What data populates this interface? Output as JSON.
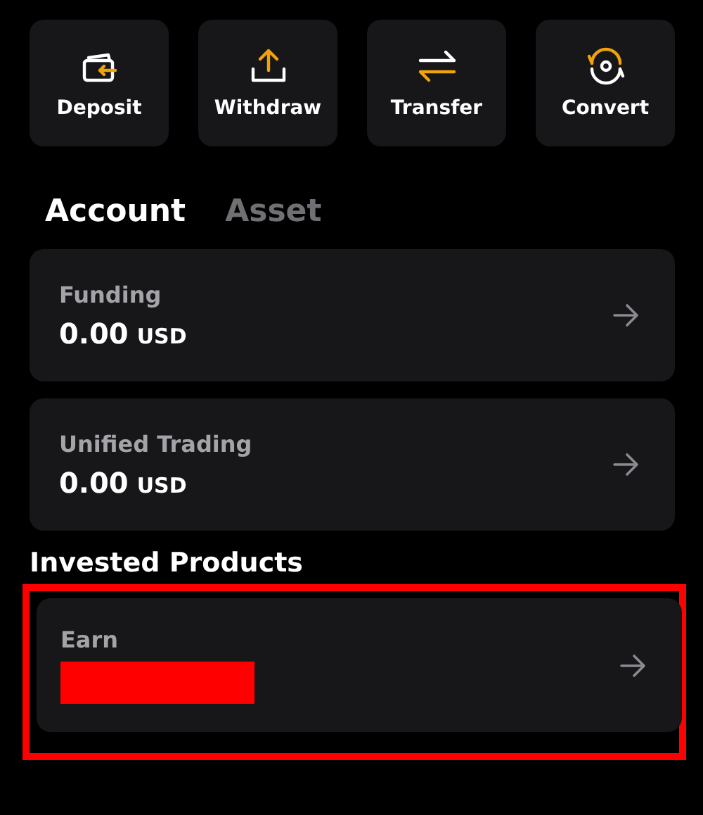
{
  "actions": [
    {
      "label": "Deposit",
      "kind": "deposit"
    },
    {
      "label": "Withdraw",
      "kind": "withdraw"
    },
    {
      "label": "Transfer",
      "kind": "transfer"
    },
    {
      "label": "Convert",
      "kind": "convert"
    }
  ],
  "tabs": [
    {
      "label": "Account",
      "selected": true
    },
    {
      "label": "Asset",
      "selected": false
    }
  ],
  "accounts": [
    {
      "name": "Funding",
      "amount": "0.00",
      "currency": "USD"
    },
    {
      "name": "Unified Trading",
      "amount": "0.00",
      "currency": "USD"
    }
  ],
  "invested_products": {
    "title": "Invested Products",
    "highlighted": true,
    "items": [
      {
        "name": "Earn",
        "redacted": true
      }
    ]
  }
}
